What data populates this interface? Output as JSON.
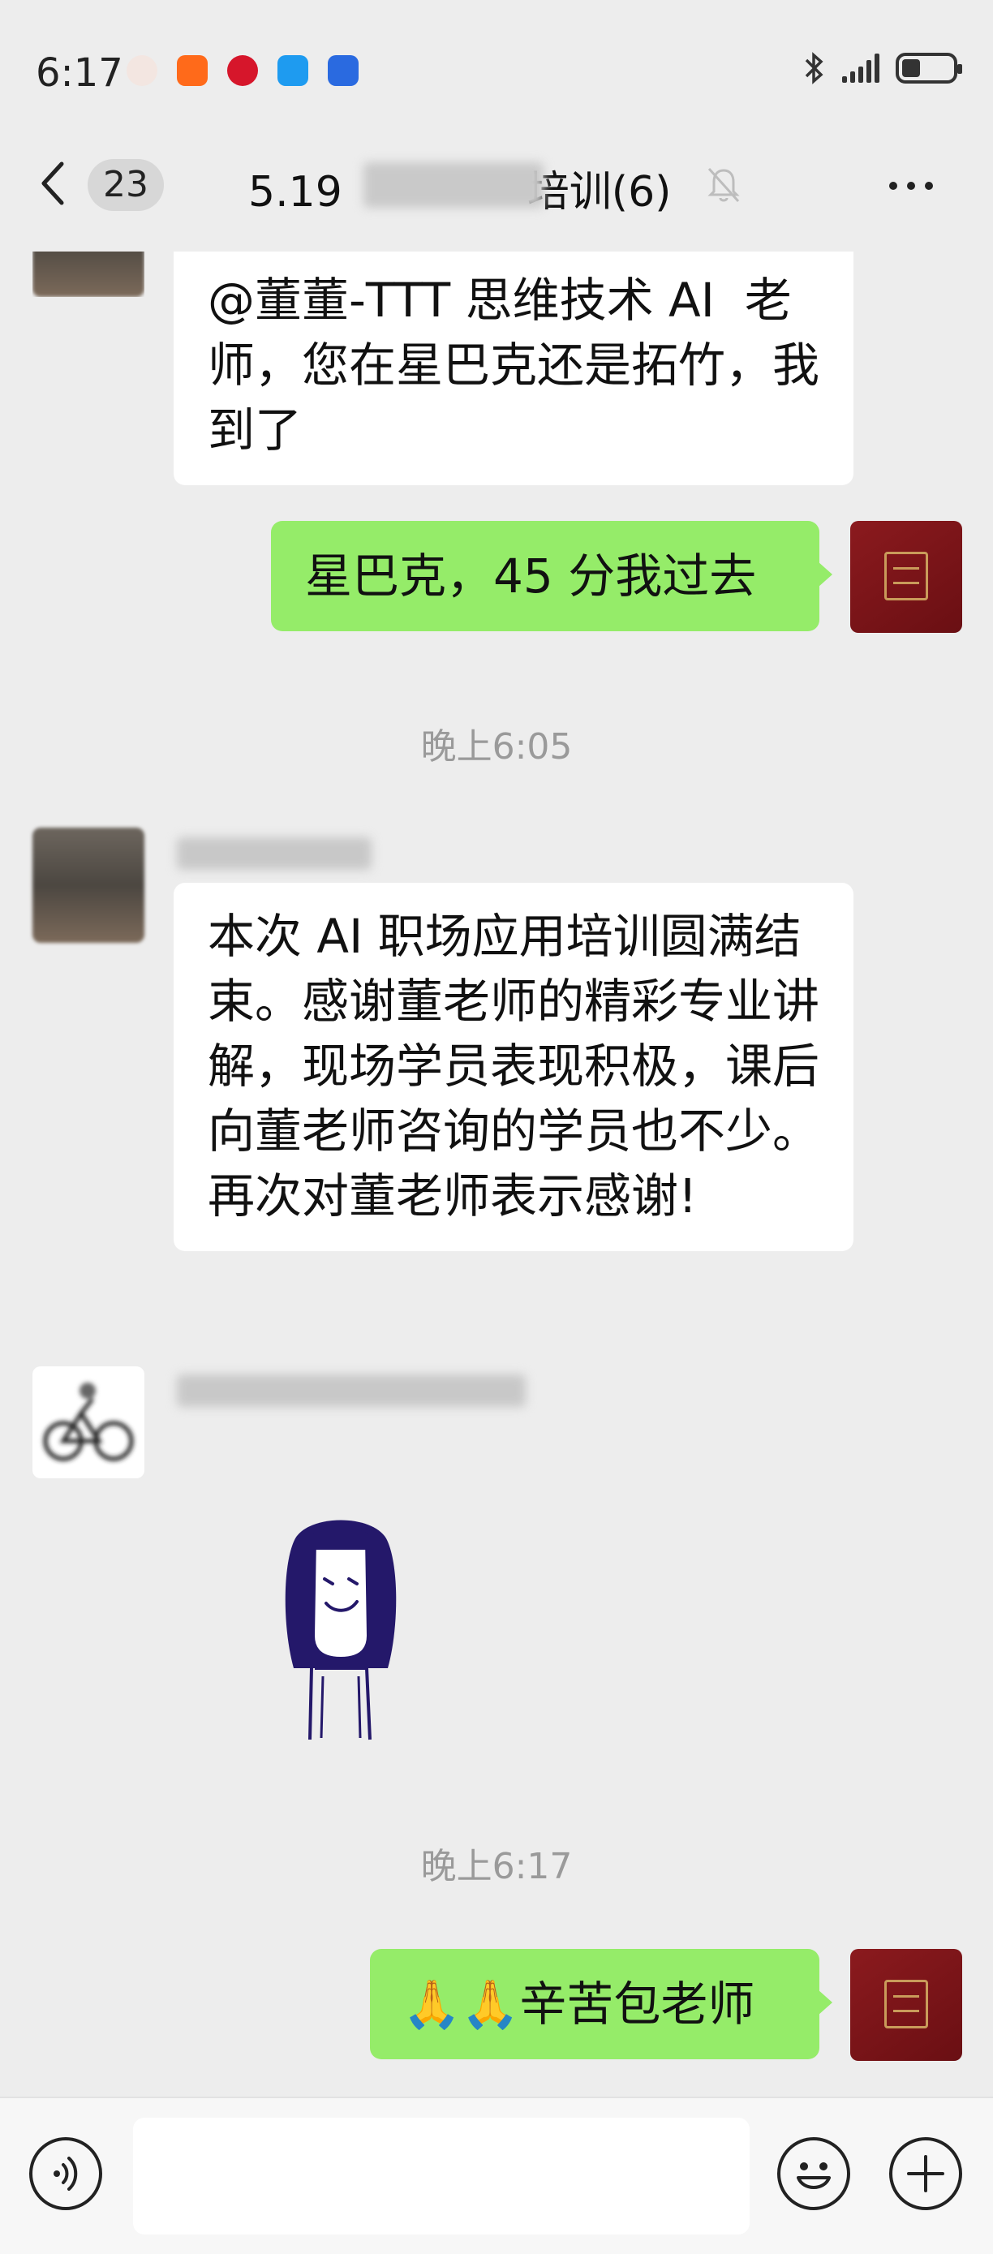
{
  "status_bar": {
    "time": "6:17",
    "icons": [
      "avatar-app-icon",
      "taobao-app-icon",
      "cmb-app-icon",
      "message-app-icon",
      "blue-app-icon"
    ],
    "right_icons": [
      "bluetooth-icon",
      "signal-icon",
      "battery-icon"
    ]
  },
  "header": {
    "unread_count": "23",
    "title_prefix": "5.19",
    "title_suffix": "培训(6)"
  },
  "messages": {
    "m1": "@董董-TTT 思维技术 AI  老师，您在星巴克还是拓竹，我到了",
    "m2": "星巴克，45 分我过去",
    "t1": "晚上6:05",
    "m3": "本次 AI 职场应用培训圆满结束。感谢董老师的精彩专业讲解，现场学员表现积极，课后向董老师咨询的学员也不少。\n再次对董老师表示感谢!",
    "t2": "晚上6:17",
    "m5": "🙏🙏辛苦包老师"
  },
  "input_bar": {
    "placeholder": ""
  },
  "colors": {
    "background": "#ededed",
    "outgoing_bubble": "#95ec69",
    "incoming_bubble": "#ffffff",
    "timestamp": "#9a9a9a"
  }
}
